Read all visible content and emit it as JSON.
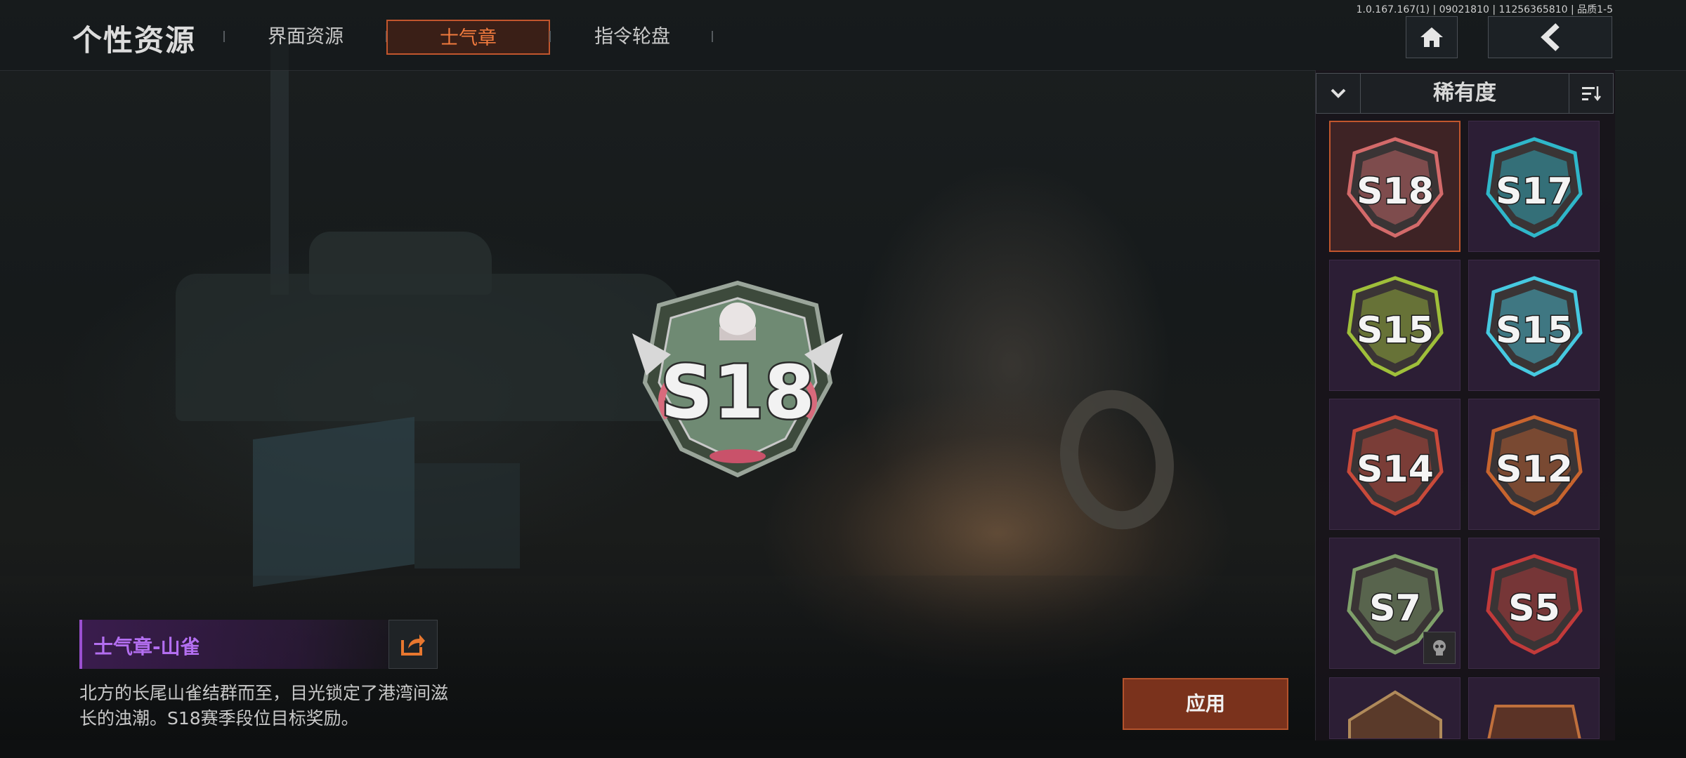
{
  "header": {
    "title": "个性资源",
    "tabs": [
      {
        "label": "界面资源",
        "active": false
      },
      {
        "label": "士气章",
        "active": true
      },
      {
        "label": "指令轮盘",
        "active": false
      }
    ],
    "version": "1.0.167.167(1) | 09021810 | 11256365810 | 品质1-5",
    "home_icon": "home-icon",
    "back_icon": "back-arrow-icon"
  },
  "main_badge": {
    "text": "S18",
    "icon": "morale-badge-s18"
  },
  "info": {
    "name": "士气章-山雀",
    "description": "北方的长尾山雀结群而至，目光锁定了港湾间滋长的浊潮。S18赛季段位目标奖励。",
    "share_icon": "share-icon"
  },
  "apply_label": "应用",
  "sort": {
    "label": "稀有度",
    "dropdown_icon": "chevron-down-icon",
    "order_icon": "sort-order-icon"
  },
  "badges": [
    {
      "text": "S18",
      "selected": true,
      "accent": "#d36a6a"
    },
    {
      "text": "S17",
      "selected": false,
      "accent": "#2fb7c9"
    },
    {
      "text": "S15",
      "selected": false,
      "accent": "#9fbf3a"
    },
    {
      "text": "S15",
      "selected": false,
      "accent": "#46c9e0"
    },
    {
      "text": "S14",
      "selected": false,
      "accent": "#c94a3a"
    },
    {
      "text": "S12",
      "selected": false,
      "accent": "#c7642e"
    },
    {
      "text": "S7",
      "selected": false,
      "accent": "#7fa06a",
      "locked": true
    },
    {
      "text": "S5",
      "selected": false,
      "accent": "#c23a3a"
    }
  ],
  "colors": {
    "accent_orange": "#c2562d",
    "epic_purple": "#b36ef0"
  }
}
